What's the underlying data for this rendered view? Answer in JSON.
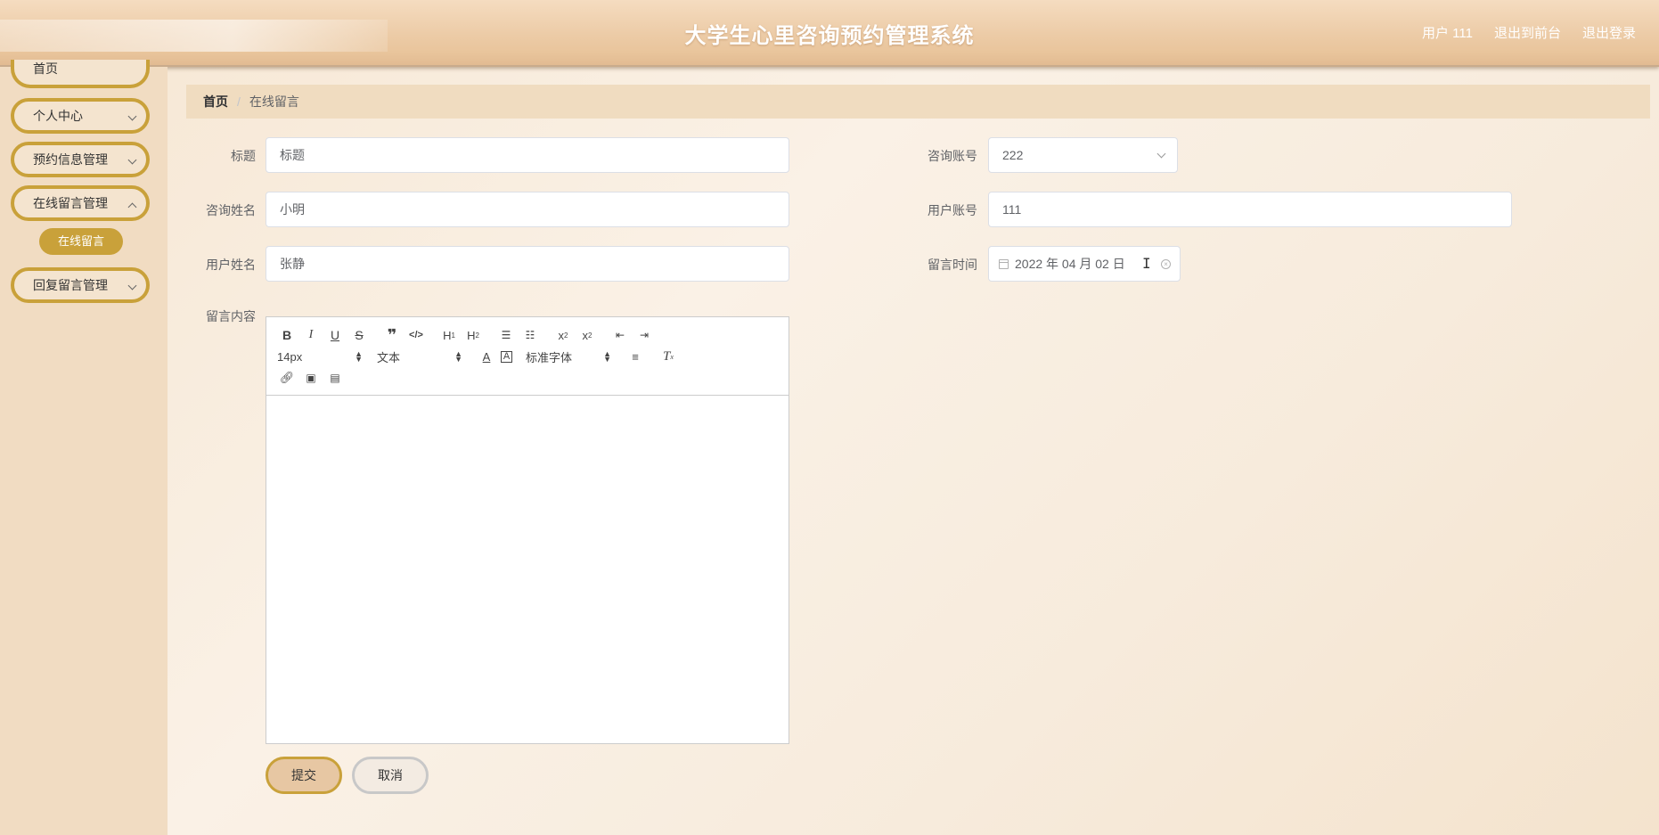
{
  "header": {
    "title": "大学生心里咨询预约管理系统",
    "user_label": "用户 111",
    "back_to_front": "退出到前台",
    "logout": "退出登录"
  },
  "sidebar": {
    "items": [
      {
        "label": "首页"
      },
      {
        "label": "个人中心"
      },
      {
        "label": "预约信息管理"
      },
      {
        "label": "在线留言管理"
      },
      {
        "label": "回复留言管理"
      }
    ],
    "sub_active": "在线留言"
  },
  "breadcrumb": {
    "home": "首页",
    "separator": "/",
    "current": "在线留言"
  },
  "form": {
    "title_label": "标题",
    "title_value": "标题",
    "consult_account_label": "咨询账号",
    "consult_account_value": "222",
    "consult_name_label": "咨询姓名",
    "consult_name_value": "小明",
    "user_account_label": "用户账号",
    "user_account_value": "111",
    "user_name_label": "用户姓名",
    "user_name_value": "张静",
    "time_label": "留言时间",
    "time_value": "2022 年 04 月 02 日",
    "content_label": "留言内容"
  },
  "editor": {
    "size_select": "14px",
    "header_select": "文本",
    "font_select": "标准字体"
  },
  "buttons": {
    "submit": "提交",
    "cancel": "取消"
  },
  "colors": {
    "accent": "#c9a13a",
    "header_bg": "#eccba6",
    "sidebar_bg": "#f1dcc2"
  }
}
